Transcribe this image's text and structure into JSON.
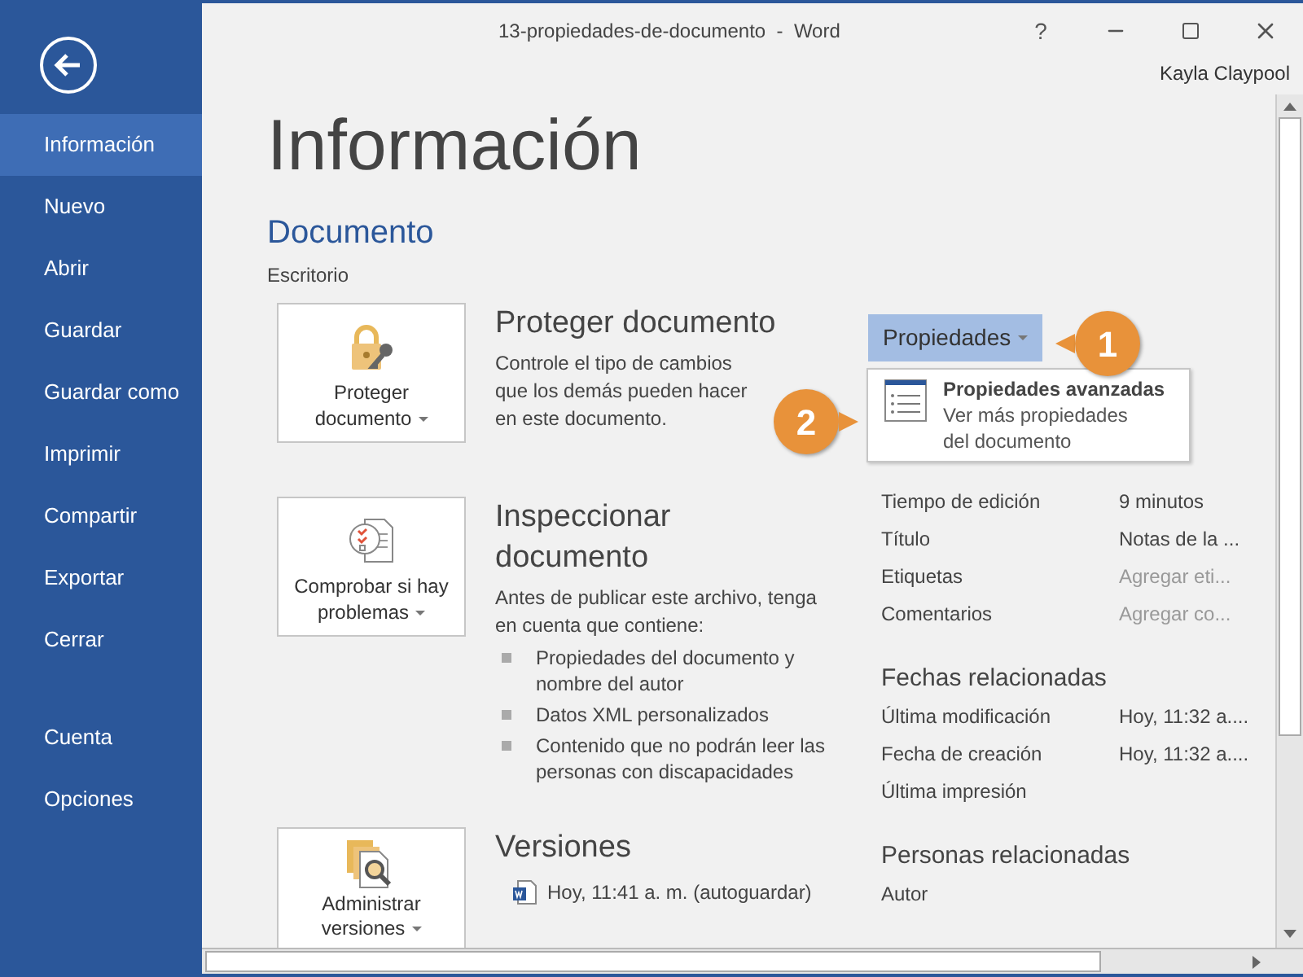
{
  "window": {
    "title": "13-propiedades-de-documento  -  Word",
    "help": "?",
    "user": "Kayla Claypool"
  },
  "sidebar": {
    "items": [
      {
        "label": "Información",
        "selected": true
      },
      {
        "label": "Nuevo",
        "selected": false
      },
      {
        "label": "Abrir",
        "selected": false
      },
      {
        "label": "Guardar",
        "selected": false
      },
      {
        "label": "Guardar como",
        "selected": false
      },
      {
        "label": "Imprimir",
        "selected": false
      },
      {
        "label": "Compartir",
        "selected": false
      },
      {
        "label": "Exportar",
        "selected": false
      },
      {
        "label": "Cerrar",
        "selected": false
      },
      {
        "label": "Cuenta",
        "selected": false
      },
      {
        "label": "Opciones",
        "selected": false
      }
    ]
  },
  "page_title": "Información",
  "document": {
    "title": "Documento",
    "location": "Escritorio"
  },
  "sections": [
    {
      "kind": "protect",
      "button": "Proteger documento",
      "title": "Proteger documento",
      "description": "Controle el tipo de cambios que los demás pueden hacer en este documento."
    },
    {
      "kind": "inspect",
      "button": "Comprobar si hay problemas",
      "title": "Inspeccionar documento",
      "description": "Antes de publicar este archivo, tenga en cuenta que contiene:",
      "bullets": [
        "Propiedades del documento y nombre del autor",
        "Datos XML personalizados",
        "Contenido que no podrán leer las personas con discapacidades"
      ]
    },
    {
      "kind": "versions",
      "button": "Administrar versiones",
      "title": "Versiones",
      "versions": [
        "Hoy, 11:41 a. m. (autoguardar)"
      ]
    }
  ],
  "properties": {
    "button": "Propiedades",
    "expanded": true,
    "menu": [
      {
        "title": "Propiedades avanzadas",
        "description": "Ver más propiedades del documento"
      }
    ],
    "rows": [
      {
        "label": "Tiempo de edición",
        "value": "9 minutos",
        "kind": "value"
      },
      {
        "label": "Título",
        "value": "Notas de la ...",
        "kind": "value"
      },
      {
        "label": "Etiquetas",
        "value": "Agregar eti...",
        "kind": "placeholder"
      },
      {
        "label": "Comentarios",
        "value": "Agregar co...",
        "kind": "placeholder"
      }
    ],
    "groups": [
      {
        "title": "Fechas relacionadas",
        "rows": [
          {
            "label": "Última modificación",
            "value": "Hoy, 11:32 a....",
            "kind": "value"
          },
          {
            "label": "Fecha de creación",
            "value": "Hoy, 11:32 a....",
            "kind": "value"
          },
          {
            "label": "Última impresión"
          }
        ]
      },
      {
        "title": "Personas relacionadas",
        "rows": [
          {
            "label": "Autor"
          }
        ]
      }
    ]
  },
  "callouts": [
    {
      "label": "1"
    },
    {
      "label": "2"
    }
  ]
}
